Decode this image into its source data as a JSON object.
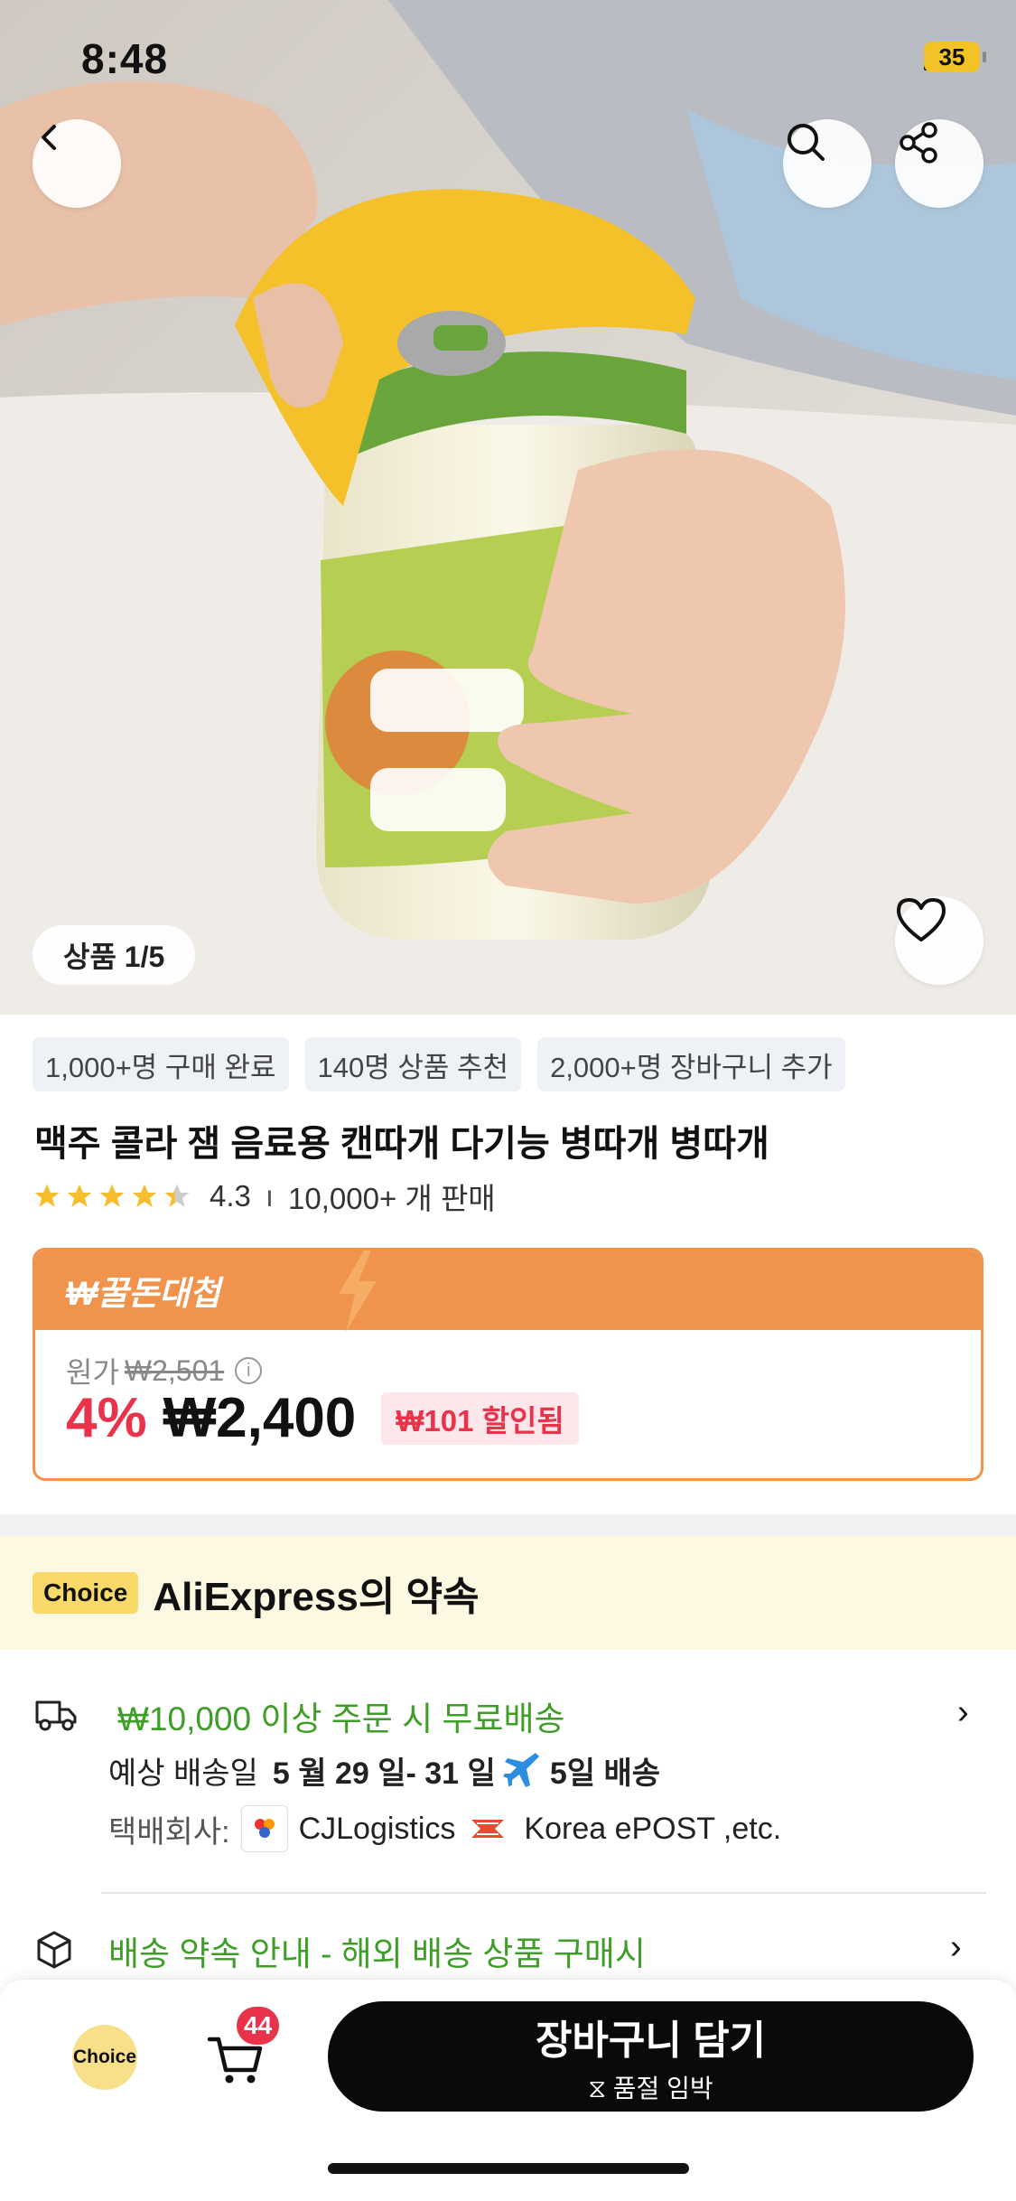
{
  "status_bar": {
    "time": "8:48",
    "battery": "35"
  },
  "gallery": {
    "counter": "상품 1/5"
  },
  "tags": [
    "1,000+명 구매 완료",
    "140명 상품 추천",
    "2,000+명 장바구니 추가"
  ],
  "product": {
    "title": "맥주 콜라 잼 음료용 캔따개 다기능 병따개 병따개",
    "rating": "4.3",
    "sold": "10,000+ 개 판매"
  },
  "price_box": {
    "header": "₩꿀돈대첩",
    "original_label": "원가",
    "original_price": "₩2,501",
    "discount_percent": "4%",
    "price": "₩2,400",
    "discount_badge": "₩101 할인됨"
  },
  "promise": {
    "choice_label": "Choice",
    "title": "AliExpress의 약속"
  },
  "shipping": {
    "free_shipping": "₩10,000 이상 주문 시 무료배송",
    "delivery_prefix": "예상 배송일",
    "delivery_dates": "5 월 29 일- 31 일",
    "delivery_days": "5일 배송",
    "carrier_label": "택배회사:",
    "carrier1": "CJLogistics",
    "carrier2": "Korea ePOST ,etc.",
    "promise_link": "배송 약속 안내 - 해외 배송 상품 구매시"
  },
  "bottom_bar": {
    "choice_label": "Choice",
    "cart_count": "44",
    "add_to_cart": "장바구니 담기",
    "stock_note": "품절 임박"
  },
  "colors": {
    "accent": "#e8334b",
    "orange": "#f0934d",
    "green": "#3e9e27"
  }
}
